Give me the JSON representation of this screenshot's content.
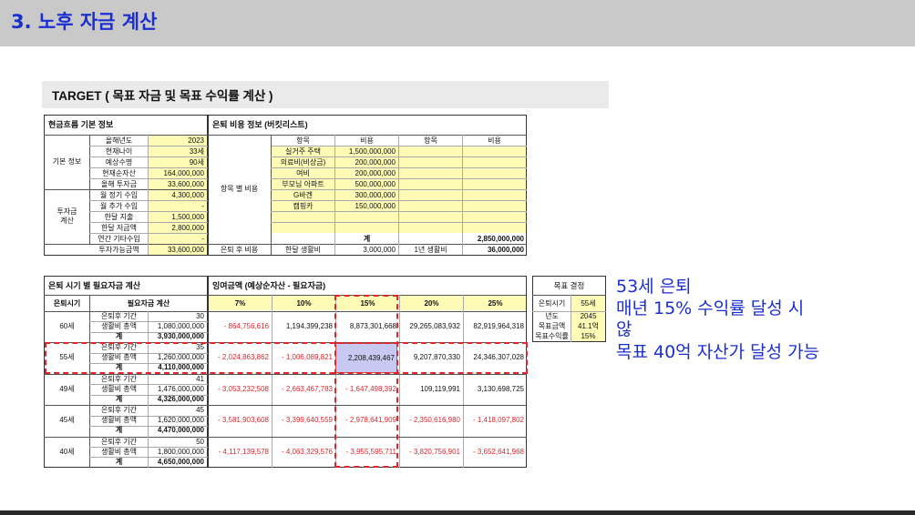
{
  "page_title": "3. 노후 자금 계산",
  "sheet_title": "TARGET ( 목표 자금 및 목표 수익률 계산 )",
  "basic": {
    "section_title": "현금흐름 기본 정보",
    "group_basic": "기본 정보",
    "group_invest": "투자금\n계산",
    "rows": [
      {
        "label": "올해년도",
        "value": "2023"
      },
      {
        "label": "현재나이",
        "value": "33세"
      },
      {
        "label": "예상수명",
        "value": "90세"
      },
      {
        "label": "현재순자산",
        "value": "164,000,000"
      },
      {
        "label": "올해 투자금",
        "value": "33,600,000"
      },
      {
        "label": "월 정기 수입",
        "value": "4,300,000"
      },
      {
        "label": "월 추가 수입",
        "value": "-"
      },
      {
        "label": "한달 지출",
        "value": "1,500,000"
      },
      {
        "label": "한달 저금액",
        "value": "2,800,000"
      },
      {
        "label": "연간 기타수입",
        "value": "-"
      },
      {
        "label": "투자가능금액",
        "value": "33,600,000"
      }
    ]
  },
  "bucket": {
    "section_title": "은퇴 비용 정보 (버킷리스트)",
    "group_label": "항목 별 비용",
    "col_headers": [
      "항목",
      "비용",
      "항목",
      "비용"
    ],
    "items": [
      {
        "name": "실거주 주택",
        "cost": "1,500,000,000"
      },
      {
        "name": "의료비(비상금)",
        "cost": "200,000,000"
      },
      {
        "name": "여비",
        "cost": "200,000,000"
      },
      {
        "name": "부모님 아파트",
        "cost": "500,000,000"
      },
      {
        "name": "G바겐",
        "cost": "300,000,000"
      },
      {
        "name": "캠핑카",
        "cost": "150,000,000"
      }
    ],
    "total_label": "계",
    "total_value": "2,850,000,000",
    "retire_label": "은퇴 후 비용",
    "monthly_label": "한달 생활비",
    "monthly_value": "3,000,000",
    "yearly_label": "1년 생활비",
    "yearly_value": "36,000,000"
  },
  "needed": {
    "section_title": "은퇴 시기 별 필요자금 계산",
    "col_age": "은퇴시기",
    "col_calc": "필요자금 계산",
    "sub_period": "은퇴후 기간",
    "sub_living": "생활비 총액",
    "sub_total": "계",
    "rows": [
      {
        "age": "60세",
        "period": "30",
        "living": "1,080,000,000",
        "total": "3,930,000,000"
      },
      {
        "age": "55세",
        "period": "35",
        "living": "1,260,000,000",
        "total": "4,110,000,000"
      },
      {
        "age": "49세",
        "period": "41",
        "living": "1,476,000,000",
        "total": "4,326,000,000"
      },
      {
        "age": "45세",
        "period": "45",
        "living": "1,620,000,000",
        "total": "4,470,000,000"
      },
      {
        "age": "40세",
        "period": "50",
        "living": "1,800,000,000",
        "total": "4,650,000,000"
      }
    ]
  },
  "surplus": {
    "section_title": "잉여금액 (예상순자산 - 필요자금)",
    "rates": [
      "7%",
      "10%",
      "15%",
      "20%",
      "25%"
    ],
    "rows": [
      [
        "- 864,756,616",
        "1,194,399,238",
        "8,873,301,668",
        "29,265,083,932",
        "82,919,964,318"
      ],
      [
        "- 2,024,863,862",
        "- 1,006,089,821",
        "2,208,439,467",
        "9,207,870,330",
        "24,346,307,028"
      ],
      [
        "- 3,053,232,508",
        "- 2,663,467,783",
        "- 1,647,498,392",
        "109,119,991",
        "3,130,698,725"
      ],
      [
        "- 3,581,903,608",
        "- 3,399,640,559",
        "- 2,978,641,909",
        "- 2,350,616,980",
        "- 1,418,097,802"
      ],
      [
        "- 4,117,139,578",
        "- 4,063,329,576",
        "- 3,955,595,711",
        "- 3,820,756,901",
        "- 3,652,641,968"
      ]
    ]
  },
  "target": {
    "section_title": "목표 결정",
    "rows": [
      {
        "label": "은퇴시기",
        "value": "55세"
      },
      {
        "label": "년도",
        "value": "2045"
      },
      {
        "label": "목표금액",
        "value": "41.1억"
      },
      {
        "label": "목표수익률",
        "value": "15%"
      }
    ]
  },
  "note": {
    "line1": "53세 은퇴",
    "line2": "매년 15% 수익률 달성 시",
    "line3": "않",
    "line4": "목표 40억 자산가 달성 가능"
  },
  "colors": {
    "title_blue": "#1b2fd0",
    "negative_red": "#e0242b",
    "input_yellow": "#fdfbb5",
    "highlight_cell": "#c7c9f2",
    "header_grey": "#c9c9c9"
  }
}
